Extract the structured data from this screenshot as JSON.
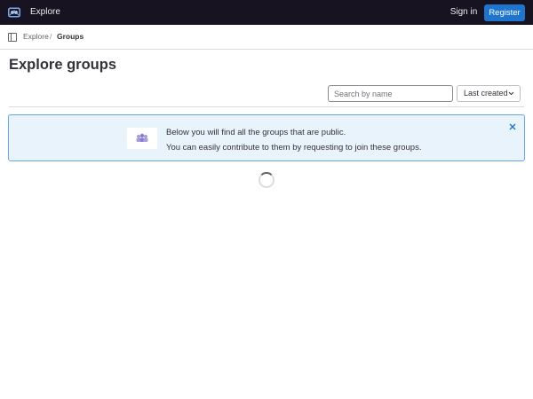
{
  "topbar": {
    "logo_icon": "tanuki-logo-icon",
    "explore_link": "Explore",
    "sign_in": "Sign in",
    "register": "Register",
    "bg_color": "#171321",
    "register_color": "#1f75cb"
  },
  "breadcrumb": {
    "toggle_icon": "sidebar-toggle-icon",
    "items": [
      "Explore",
      "Groups"
    ],
    "separator": "/"
  },
  "page": {
    "title": "Explore groups"
  },
  "filter": {
    "search_placeholder": "Search by name",
    "sort_selected": "Last created",
    "sort_icon": "chevron-down-icon"
  },
  "alert": {
    "line1": "Below you will find all the groups that are public.",
    "line2": "You can easily contribute to them by requesting to join these groups.",
    "illustration_icon": "groups-illustration-icon",
    "close_icon": "close-icon",
    "bg_color": "#e9f3fc",
    "border_color": "#63a6e9"
  },
  "loading": {
    "icon": "loading-spinner-icon"
  }
}
